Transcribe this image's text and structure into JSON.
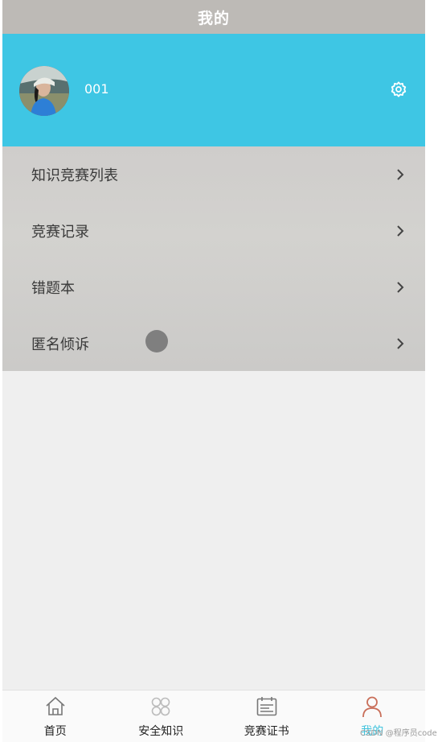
{
  "header": {
    "title": "我的"
  },
  "profile": {
    "username": "001",
    "avatar_icon": "avatar-photo",
    "settings_icon": "gear-icon"
  },
  "menu": {
    "items": [
      {
        "label": "知识竞赛列表"
      },
      {
        "label": "竞赛记录"
      },
      {
        "label": "错题本"
      },
      {
        "label": "匿名倾诉"
      }
    ]
  },
  "tabbar": {
    "tabs": [
      {
        "label": "首页",
        "icon": "home-icon"
      },
      {
        "label": "安全知识",
        "icon": "grid-icon"
      },
      {
        "label": "竞赛证书",
        "icon": "certificate-icon"
      },
      {
        "label": "我的",
        "icon": "user-icon",
        "active": true
      }
    ]
  },
  "watermark": "CSDN @程序员code",
  "colors": {
    "accent": "#3ec6e4",
    "title_bar": "#bdbab6",
    "tab_active": "#41c3dd"
  }
}
